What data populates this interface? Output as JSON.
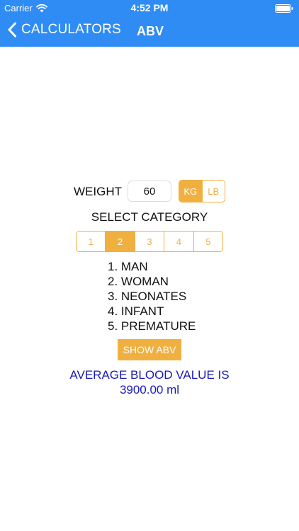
{
  "status_bar": {
    "carrier": "Carrier",
    "time": "4:52 PM",
    "wifi_icon": "wifi-icon",
    "battery_icon": "battery-icon"
  },
  "nav": {
    "back_label": "CALCULATORS",
    "back_icon": "chevron-left-icon",
    "title": "ABV",
    "bar_color": "#2f8cf4"
  },
  "weight": {
    "label": "WEIGHT",
    "value": "60",
    "units": [
      "KG",
      "LB"
    ],
    "selected_unit": "KG"
  },
  "category": {
    "heading": "SELECT CATEGORY",
    "options": [
      "1",
      "2",
      "3",
      "4",
      "5"
    ],
    "selected": "2",
    "list": [
      "1. MAN",
      "2. WOMAN",
      "3. NEONATES",
      "4. INFANT",
      "5. PREMATURE"
    ]
  },
  "action": {
    "show_label": "SHOW ABV"
  },
  "result": {
    "label": "AVERAGE BLOOD VALUE IS",
    "value": "3900.00 ml",
    "color": "#1a1ab8"
  },
  "accent_color": "#f0b040"
}
